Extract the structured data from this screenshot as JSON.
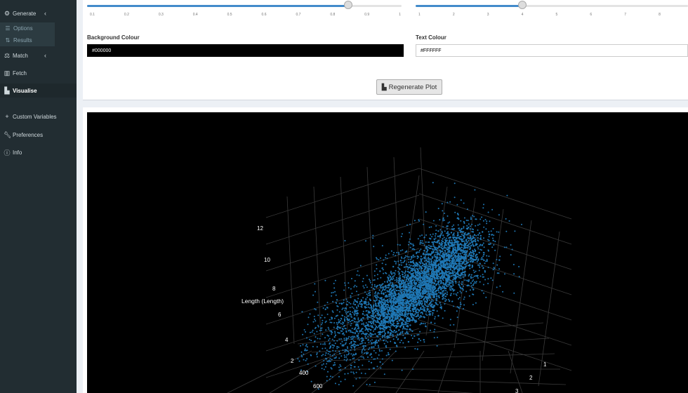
{
  "sidebar": {
    "items": [
      {
        "label": "Generate",
        "icon": "cogs-icon",
        "chevron": "‹"
      },
      {
        "label": "Options",
        "icon": "sliders-icon"
      },
      {
        "label": "Results",
        "icon": "sort-icon"
      },
      {
        "label": "Match",
        "icon": "balance-scale-icon",
        "chevron": "‹"
      },
      {
        "label": "Fetch",
        "icon": "building-icon"
      },
      {
        "label": "Visualise",
        "icon": "bar-chart-icon"
      },
      {
        "label": "Custom Variables",
        "icon": "plus-icon"
      },
      {
        "label": "Preferences",
        "icon": "wrench-icon"
      },
      {
        "label": "Info",
        "icon": "info-circle-icon"
      }
    ]
  },
  "controls": {
    "slider_left": {
      "ticks": [
        "0.1",
        "0.2",
        "0.3",
        "0.4",
        "0.5",
        "0.6",
        "0.7",
        "0.8",
        "0.9",
        "1"
      ],
      "value": 0.8
    },
    "slider_right": {
      "ticks": [
        "1",
        "2",
        "3",
        "4",
        "5",
        "6",
        "7",
        "8"
      ],
      "value": 4
    },
    "background_colour": {
      "label": "Background Colour",
      "value": "#000000"
    },
    "text_colour": {
      "label": "Text Colour",
      "value": "#FFFFFF"
    },
    "regenerate_button": "Regenerate Plot"
  },
  "chart_data": {
    "type": "scatter",
    "z_title": "Length (Length)",
    "z_ticks": [
      "12",
      "10",
      "8",
      "6",
      "4",
      "2"
    ],
    "x_ticks": [
      "400",
      "600"
    ],
    "y_ticks": [
      "1",
      "2",
      "3"
    ],
    "point_color": "#1f77b4",
    "background": "#000000"
  },
  "colors": {
    "accent": "#428bca",
    "sidebar": "#222d32"
  }
}
